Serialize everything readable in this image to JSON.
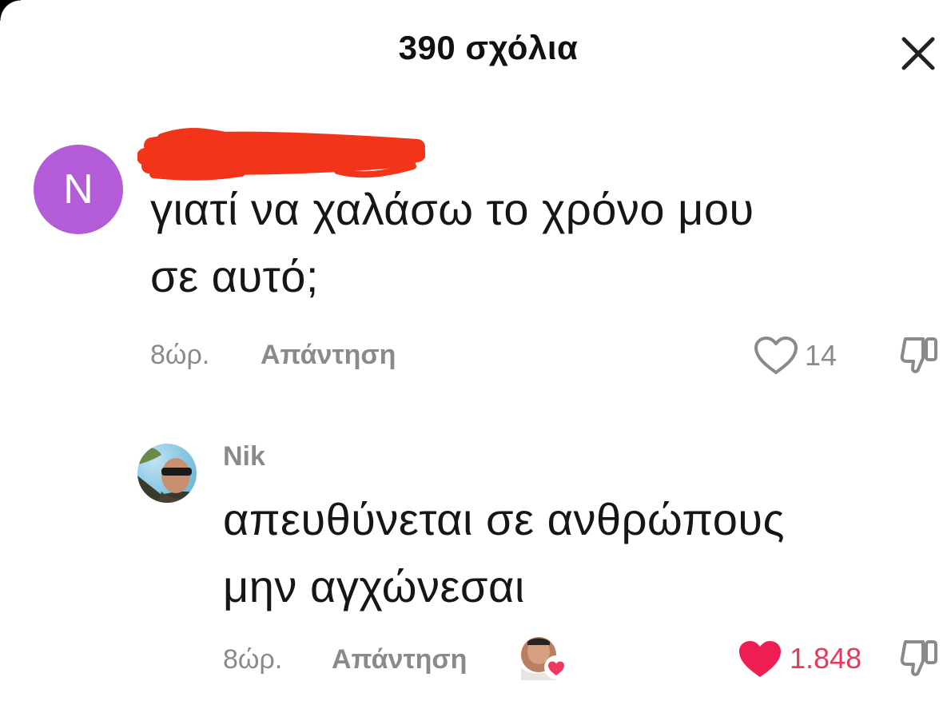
{
  "header": {
    "title": "390 σχόλια"
  },
  "comments": [
    {
      "avatar_letter": "N",
      "text_line1": "γιατί να χαλάσω το χρόνο μου",
      "text_line2": "σε αυτό;",
      "time": "8ώρ.",
      "reply_label": "Απάντηση",
      "likes": "14",
      "liked": false
    },
    {
      "username": "Nik",
      "text_line1": "απευθύνεται σε ανθρώπους",
      "text_line2": "μην αγχώνεσαι",
      "time": "8ώρ.",
      "reply_label": "Απάντηση",
      "likes": "1.848",
      "liked": true
    }
  ],
  "colors": {
    "like_active": "#e8395a",
    "muted": "#8a8a8a",
    "avatar_bg": "#b45cd8",
    "redaction": "#f2351a"
  },
  "icons": [
    "close-icon",
    "heart-outline-icon",
    "heart-filled-icon",
    "dislike-icon"
  ]
}
